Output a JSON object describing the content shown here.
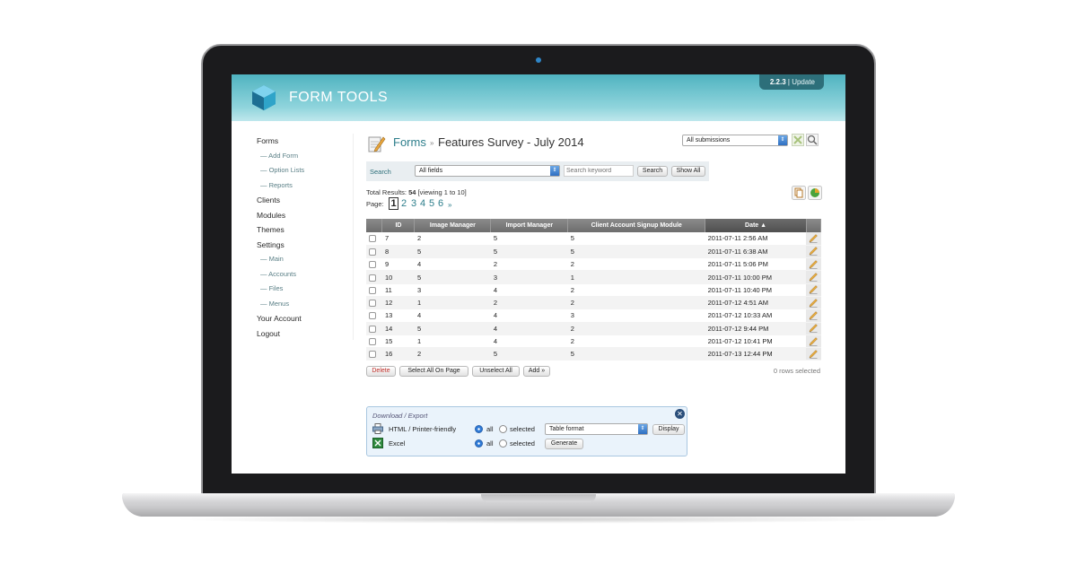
{
  "app": {
    "logo_text": "FORM TOOLS",
    "version": "2.2.3",
    "version_sep": "|",
    "update_label": "Update"
  },
  "nav": {
    "forms": "Forms",
    "add_form": "— Add Form",
    "option_lists": "— Option Lists",
    "reports": "— Reports",
    "clients": "Clients",
    "modules": "Modules",
    "themes": "Themes",
    "settings": "Settings",
    "main": "— Main",
    "accounts": "— Accounts",
    "files": "— Files",
    "menus": "— Menus",
    "your_account": "Your Account",
    "logout": "Logout"
  },
  "breadcrumb": {
    "forms": "Forms",
    "separator": "»",
    "title": "Features Survey - July 2014"
  },
  "view_select": {
    "value": "All submissions"
  },
  "search": {
    "label": "Search",
    "field_value": "All fields",
    "placeholder": "Search keyword",
    "search_button": "Search",
    "show_all_button": "Show All"
  },
  "results": {
    "total_label": "Total Results:",
    "total": "54",
    "viewing": "[viewing 1 to 10]",
    "page_label": "Page:",
    "pages": [
      "1",
      "2",
      "3",
      "4",
      "5",
      "6"
    ],
    "current_page": "1",
    "next": "»"
  },
  "table": {
    "headers": [
      "ID",
      "Image Manager",
      "Import Manager",
      "Client Account Signup Module",
      "Date ▲"
    ],
    "rows": [
      [
        "7",
        "2",
        "5",
        "5",
        "2011-07-11 2:56 AM"
      ],
      [
        "8",
        "5",
        "5",
        "5",
        "2011-07-11 6:38 AM"
      ],
      [
        "9",
        "4",
        "2",
        "2",
        "2011-07-11 5:06 PM"
      ],
      [
        "10",
        "5",
        "3",
        "1",
        "2011-07-11 10:00 PM"
      ],
      [
        "11",
        "3",
        "4",
        "2",
        "2011-07-11 10:40 PM"
      ],
      [
        "12",
        "1",
        "2",
        "2",
        "2011-07-12 4:51 AM"
      ],
      [
        "13",
        "4",
        "4",
        "3",
        "2011-07-12 10:33 AM"
      ],
      [
        "14",
        "5",
        "4",
        "2",
        "2011-07-12 9:44 PM"
      ],
      [
        "15",
        "1",
        "4",
        "2",
        "2011-07-12 10:41 PM"
      ],
      [
        "16",
        "2",
        "5",
        "5",
        "2011-07-13 12:44 PM"
      ]
    ]
  },
  "actions": {
    "delete": "Delete",
    "select_all": "Select All On Page",
    "unselect_all": "Unselect All",
    "add": "Add »",
    "rows_selected": "0 rows selected"
  },
  "export": {
    "title": "Download / Export",
    "html_label": "HTML / Printer-friendly",
    "excel_label": "Excel",
    "all": "all",
    "selected": "selected",
    "format_value": "Table format",
    "display_button": "Display",
    "generate_button": "Generate"
  },
  "colors": {
    "header_teal": "#4fb3c0",
    "link_teal": "#2d7e8b",
    "table_header": "#7a7a7a",
    "delete_red": "#c0312b"
  }
}
